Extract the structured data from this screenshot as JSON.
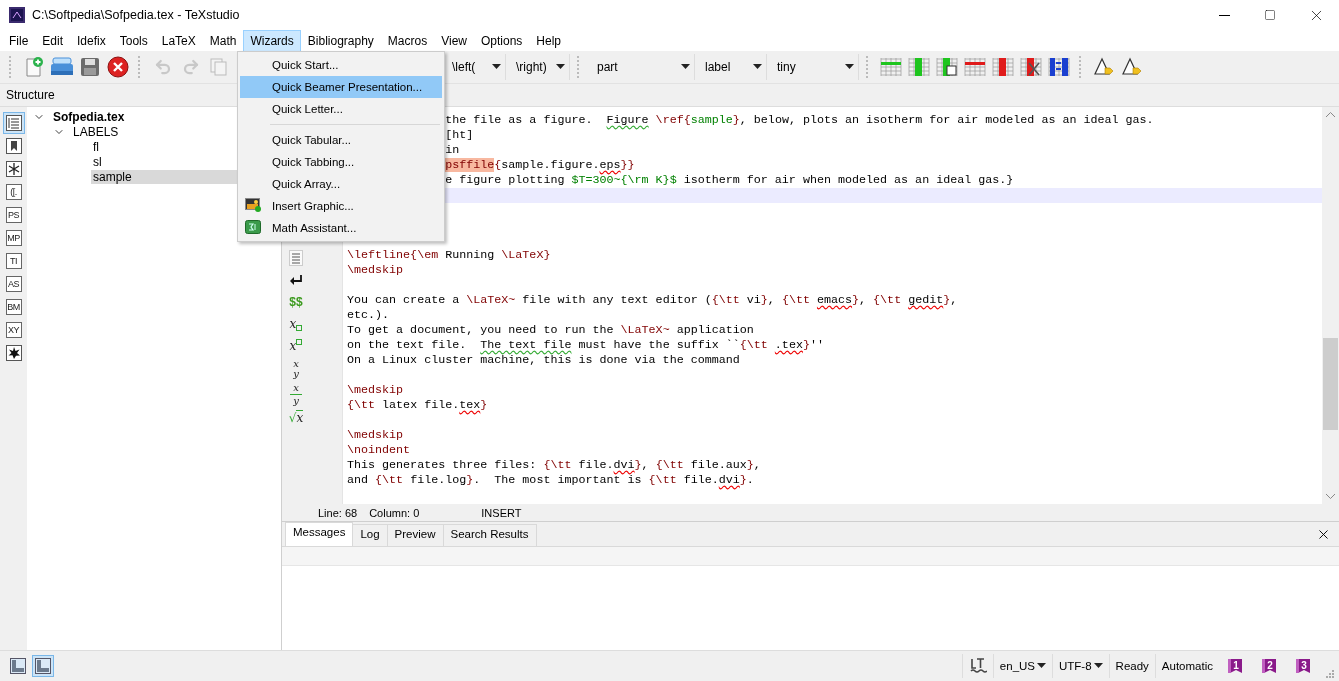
{
  "window": {
    "title": "C:\\Softpedia\\Sofpedia.tex - TeXstudio"
  },
  "menu_bar": [
    {
      "label": "File",
      "selected": false
    },
    {
      "label": "Edit",
      "selected": false
    },
    {
      "label": "Idefix",
      "selected": false
    },
    {
      "label": "Tools",
      "selected": false
    },
    {
      "label": "LaTeX",
      "selected": false
    },
    {
      "label": "Math",
      "selected": false
    },
    {
      "label": "Wizards",
      "selected": true
    },
    {
      "label": "Bibliography",
      "selected": false
    },
    {
      "label": "Macros",
      "selected": false
    },
    {
      "label": "View",
      "selected": false
    },
    {
      "label": "Options",
      "selected": false
    },
    {
      "label": "Help",
      "selected": false
    }
  ],
  "open_menu": [
    {
      "kind": "plain",
      "label": "Quick Start...",
      "selected": false
    },
    {
      "kind": "plain",
      "label": "Quick Beamer Presentation...",
      "selected": true
    },
    {
      "kind": "plain",
      "label": "Quick Letter...",
      "selected": false
    },
    {
      "kind": "separator"
    },
    {
      "kind": "plain",
      "label": "Quick Tabular...",
      "selected": false
    },
    {
      "kind": "plain",
      "label": "Quick Tabbing...",
      "selected": false
    },
    {
      "kind": "plain",
      "label": "Quick Array...",
      "selected": false
    },
    {
      "kind": "graphic",
      "label": "Insert Graphic...",
      "selected": false
    },
    {
      "kind": "math",
      "label": "Math Assistant...",
      "selected": false
    }
  ],
  "toolbar": {
    "combos": [
      "\\left(",
      "\\right)",
      "part",
      "label",
      "tiny"
    ]
  },
  "structure": {
    "title": "Structure",
    "tools": [
      {
        "kind": "outline",
        "selected": true
      },
      {
        "kind": "bookmark",
        "selected": false
      },
      {
        "kind": "asterisk",
        "selected": false
      },
      {
        "kind": "text",
        "label": "([.",
        "selected": false
      },
      {
        "kind": "text",
        "label": "PS",
        "selected": false
      },
      {
        "kind": "text",
        "label": "MP",
        "selected": false
      },
      {
        "kind": "text",
        "label": "TI",
        "selected": false
      },
      {
        "kind": "text",
        "label": "AS",
        "selected": false
      },
      {
        "kind": "text",
        "label": "BM",
        "selected": false
      },
      {
        "kind": "text",
        "label": "XY",
        "selected": false
      },
      {
        "kind": "splat",
        "selected": false
      }
    ],
    "tree": [
      {
        "label": "Sofpedia.tex",
        "expanded": true,
        "selected": false,
        "children": [
          {
            "label": "LABELS",
            "expanded": true,
            "selected": false,
            "children": [
              {
                "label": "fl",
                "selected": false
              },
              {
                "label": "sl",
                "selected": false
              },
              {
                "label": "sample",
                "selected": true
              }
            ]
          }
        ]
      }
    ]
  },
  "symbols": [
    {
      "kind": "list"
    },
    {
      "kind": "return"
    },
    {
      "kind": "text",
      "label": "$$"
    },
    {
      "kind": "sub",
      "label": "x"
    },
    {
      "kind": "sup",
      "label": "x"
    },
    {
      "kind": "frac",
      "top": "x",
      "bottom": "y"
    },
    {
      "kind": "slash",
      "top": "x",
      "bottom": "y"
    },
    {
      "kind": "sqrt",
      "radical": "√",
      "label": "x"
    }
  ],
  "editor": {
    "lines": [
      {
        "kind": "code",
        "partial": true,
        "segments": [
          {
            "kind": "plain",
            "text": "the file as a figure.  "
          },
          {
            "kind": "grammar",
            "text": "Figure"
          },
          {
            "kind": "cmd",
            "text": " \\ref{"
          },
          {
            "kind": "arg",
            "text": "sample"
          },
          {
            "kind": "cmd",
            "text": "}"
          },
          {
            "kind": "plain",
            "text": ", below, plots an isotherm for air modeled as an ideal gas."
          }
        ]
      },
      {
        "kind": "code",
        "partial": true,
        "segments": [
          {
            "kind": "plain",
            "text": "[ht]"
          }
        ]
      },
      {
        "kind": "code",
        "partial": true,
        "segments": [
          {
            "kind": "plain",
            "text": "in"
          }
        ]
      },
      {
        "kind": "code",
        "partial": true,
        "segments": [
          {
            "kind": "mark",
            "text": "psffile"
          },
          {
            "kind": "cmd",
            "text": "{"
          },
          {
            "kind": "plain",
            "text": "sample.figure."
          },
          {
            "kind": "spell",
            "text": "eps"
          },
          {
            "kind": "cmd",
            "text": "}}"
          }
        ]
      },
      {
        "kind": "code",
        "partial": true,
        "segments": [
          {
            "kind": "plain",
            "text": "e figure plotting "
          },
          {
            "kind": "math",
            "text": "$T=300~{\\rm K}$"
          },
          {
            "kind": "plain",
            "text": " isotherm for air when modeled as an ideal gas.}"
          }
        ]
      },
      {
        "kind": "blank",
        "current": true
      },
      {
        "kind": "blank"
      },
      {
        "kind": "blank"
      },
      {
        "kind": "blank"
      },
      {
        "kind": "code",
        "segments": [
          {
            "kind": "cmd",
            "text": "\\leftline{\\em"
          },
          {
            "kind": "plain",
            "text": " Running "
          },
          {
            "kind": "cmd",
            "text": "\\LaTeX}"
          }
        ]
      },
      {
        "kind": "code",
        "segments": [
          {
            "kind": "cmd",
            "text": "\\medskip"
          }
        ]
      },
      {
        "kind": "blank"
      },
      {
        "kind": "code",
        "segments": [
          {
            "kind": "plain",
            "text": "You can create a "
          },
          {
            "kind": "cmd",
            "text": "\\LaTeX~"
          },
          {
            "kind": "plain",
            "text": " file with any text editor ("
          },
          {
            "kind": "cmd",
            "text": "{\\tt"
          },
          {
            "kind": "plain",
            "text": " vi"
          },
          {
            "kind": "cmd",
            "text": "}"
          },
          {
            "kind": "plain",
            "text": ", "
          },
          {
            "kind": "cmd",
            "text": "{\\tt "
          },
          {
            "kind": "spell",
            "text": "emacs"
          },
          {
            "kind": "cmd",
            "text": "}"
          },
          {
            "kind": "plain",
            "text": ", "
          },
          {
            "kind": "cmd",
            "text": "{\\tt "
          },
          {
            "kind": "spell",
            "text": "gedit"
          },
          {
            "kind": "cmd",
            "text": "}"
          },
          {
            "kind": "plain",
            "text": ","
          }
        ]
      },
      {
        "kind": "code",
        "segments": [
          {
            "kind": "plain",
            "text": "etc.)."
          }
        ]
      },
      {
        "kind": "code",
        "segments": [
          {
            "kind": "plain",
            "text": "To get a document, you need to run the "
          },
          {
            "kind": "cmd",
            "text": "\\LaTeX~"
          },
          {
            "kind": "plain",
            "text": " application"
          }
        ]
      },
      {
        "kind": "code",
        "segments": [
          {
            "kind": "plain",
            "text": "on the text file.  "
          },
          {
            "kind": "grammar",
            "text": "The text file"
          },
          {
            "kind": "plain",
            "text": " must have the suffix ``"
          },
          {
            "kind": "cmd",
            "text": "{\\tt "
          },
          {
            "kind": "spell",
            "text": ".tex"
          },
          {
            "kind": "cmd",
            "text": "}"
          },
          {
            "kind": "plain",
            "text": "''"
          }
        ]
      },
      {
        "kind": "code",
        "segments": [
          {
            "kind": "plain",
            "text": "On a Linux cluster machine, this is done via the command"
          }
        ]
      },
      {
        "kind": "blank"
      },
      {
        "kind": "code",
        "segments": [
          {
            "kind": "cmd",
            "text": "\\medskip"
          }
        ]
      },
      {
        "kind": "code",
        "segments": [
          {
            "kind": "cmd",
            "text": "{\\tt"
          },
          {
            "kind": "plain",
            "text": " latex file."
          },
          {
            "kind": "spell",
            "text": "tex"
          },
          {
            "kind": "cmd",
            "text": "}"
          }
        ]
      },
      {
        "kind": "blank"
      },
      {
        "kind": "code",
        "segments": [
          {
            "kind": "cmd",
            "text": "\\medskip"
          }
        ]
      },
      {
        "kind": "code",
        "segments": [
          {
            "kind": "cmd",
            "text": "\\noindent"
          }
        ]
      },
      {
        "kind": "code",
        "segments": [
          {
            "kind": "plain",
            "text": "This generates three files: "
          },
          {
            "kind": "cmd",
            "text": "{\\tt"
          },
          {
            "kind": "plain",
            "text": " file."
          },
          {
            "kind": "spell",
            "text": "dvi"
          },
          {
            "kind": "cmd",
            "text": "}"
          },
          {
            "kind": "plain",
            "text": ", "
          },
          {
            "kind": "cmd",
            "text": "{\\tt"
          },
          {
            "kind": "plain",
            "text": " file.aux"
          },
          {
            "kind": "cmd",
            "text": "}"
          },
          {
            "kind": "plain",
            "text": ","
          }
        ]
      },
      {
        "kind": "code",
        "segments": [
          {
            "kind": "plain",
            "text": "and "
          },
          {
            "kind": "cmd",
            "text": "{\\tt"
          },
          {
            "kind": "plain",
            "text": " file.log"
          },
          {
            "kind": "cmd",
            "text": "}"
          },
          {
            "kind": "plain",
            "text": ".  The most important is "
          },
          {
            "kind": "cmd",
            "text": "{\\tt"
          },
          {
            "kind": "plain",
            "text": " file."
          },
          {
            "kind": "spell",
            "text": "dvi"
          },
          {
            "kind": "cmd",
            "text": "}"
          },
          {
            "kind": "plain",
            "text": "."
          }
        ]
      }
    ],
    "status": [
      "Line: 68",
      "Column: 0",
      "INSERT"
    ]
  },
  "bottom_panel": {
    "tabs": [
      {
        "label": "Messages",
        "selected": true
      },
      {
        "label": "Log",
        "selected": false
      },
      {
        "label": "Preview",
        "selected": false
      },
      {
        "label": "Search Results",
        "selected": false
      }
    ]
  },
  "status_bar": {
    "layout_toggles": [
      {
        "selected": false
      },
      {
        "selected": true
      }
    ],
    "language": "en_US",
    "encoding": "UTF-8",
    "state": "Ready",
    "mode": "Automatic",
    "bookmarks": [
      "1",
      "2",
      "3"
    ]
  }
}
